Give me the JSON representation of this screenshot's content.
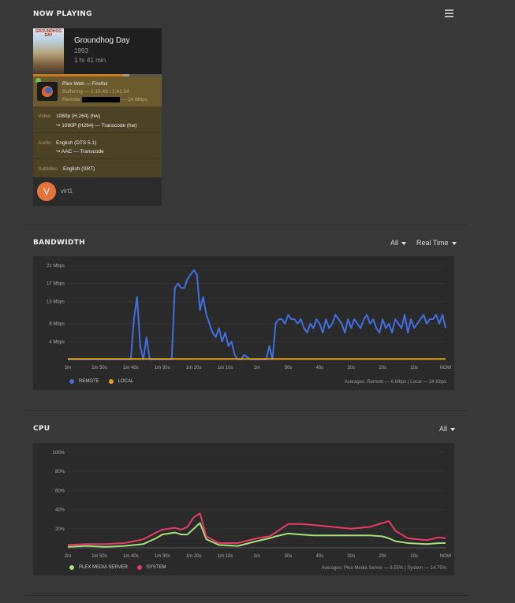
{
  "now_playing": {
    "title": "NOW PLAYING",
    "poster_text": "GROUNDHOG DAY",
    "movie_title": "Groundhog Day",
    "year": "1993",
    "duration": "1 hr 41 min",
    "progress": 0.7,
    "buffer": 0.75,
    "player_line1": "Plex Web  —  Firefox",
    "player_line2": "Buffering — 1:10:49 / 1:41:04",
    "player_remote_label": "Remote",
    "player_remote_suffix": "— 14 Mbps",
    "video_label": "Video",
    "video_value": "1080p (H.264) (hw)",
    "video_transcode": "↪  1080P (H264) — Transcode (hw)",
    "audio_label": "Audio",
    "audio_value": "English (DTS 5.1)",
    "audio_transcode": "↪  AAC — Transcode",
    "subtitles_label": "Subtitles",
    "subtitles_value": "English (SRT)",
    "avatar_letter": "V",
    "username": "virt1"
  },
  "bandwidth": {
    "title": "BANDWIDTH",
    "filter_label": "All",
    "range_label": "Real Time",
    "legend_remote": "REMOTE",
    "legend_local": "LOCAL",
    "averages": "Averages: Remote — 6 Mbps | Local — 24 Kbps",
    "remote_color": "#3f6fe0",
    "local_color": "#e8a020"
  },
  "cpu": {
    "title": "CPU",
    "filter_label": "All",
    "legend_server": "PLEX MEDIA SERVER",
    "legend_system": "SYSTEM",
    "averages": "Averages: Plex Media Server — 8.55% | System — 14.75%",
    "server_color": "#a6e07a",
    "system_color": "#e83a64"
  },
  "chart_data": [
    {
      "type": "line",
      "title": "BANDWIDTH",
      "x_ticks": [
        "2m",
        "1m 50s",
        "1m 40s",
        "1m 30s",
        "1m 20s",
        "1m 10s",
        "1m",
        "50s",
        "40s",
        "30s",
        "20s",
        "10s",
        "NOW"
      ],
      "y_ticks": [
        "4 Mbps",
        "8 Mbps",
        "13 Mbps",
        "17 Mbps",
        "21 Mbps"
      ],
      "ylim": [
        0,
        21
      ],
      "x_seconds_ago": [
        120,
        118,
        116,
        112,
        106,
        104,
        102,
        100,
        99,
        98,
        97,
        96,
        95,
        94,
        93,
        92,
        91,
        90,
        88,
        87,
        86,
        85,
        84,
        83,
        82,
        81,
        80,
        79,
        78,
        77,
        76,
        75,
        74,
        73,
        72,
        71,
        70,
        69,
        68,
        67,
        66,
        65,
        64,
        62,
        61,
        60,
        58,
        57,
        56,
        55,
        54,
        53,
        52,
        51,
        50,
        49,
        48,
        47,
        46,
        45,
        44,
        43,
        42,
        41,
        40,
        39,
        38,
        37,
        36,
        35,
        34,
        33,
        32,
        31,
        30,
        29,
        28,
        27,
        26,
        25,
        24,
        23,
        22,
        21,
        20,
        19,
        18,
        17,
        16,
        15,
        14,
        13,
        12,
        11,
        10,
        9,
        8,
        7,
        6,
        5,
        4,
        3,
        2,
        1,
        0
      ],
      "series": [
        {
          "name": "REMOTE",
          "values": [
            0,
            0,
            0,
            0,
            0,
            0,
            0,
            0,
            9,
            14,
            3,
            0,
            5,
            0,
            0,
            0,
            0,
            0,
            0,
            0,
            16,
            17,
            16,
            16,
            18,
            19,
            20,
            19,
            11,
            14,
            10,
            8,
            6,
            5,
            7,
            4,
            6,
            3,
            4,
            1,
            0,
            0,
            1,
            0,
            0,
            0,
            0,
            0,
            3,
            0,
            8,
            9,
            9,
            8,
            10,
            9,
            9,
            8,
            9,
            7,
            6,
            8,
            7,
            9,
            8,
            6,
            9,
            7,
            8,
            10,
            9,
            8,
            6,
            9,
            7,
            9,
            8,
            7,
            9,
            10,
            8,
            9,
            7,
            6,
            9,
            7,
            8,
            6,
            9,
            8,
            7,
            10,
            6,
            9,
            7,
            8,
            9,
            10,
            8,
            9,
            9,
            10,
            8,
            10,
            7
          ]
        },
        {
          "name": "LOCAL",
          "values": [
            0.1,
            0.1,
            0.1,
            0.1,
            0.1,
            0.1,
            0.1,
            0.1,
            0.1,
            0.1,
            0.1,
            0.1,
            0.1,
            0.1,
            0.1,
            0.1,
            0.1,
            0.1,
            0.1,
            0.1,
            0.1,
            0.1,
            0.1,
            0.1,
            0.1,
            0.1,
            0.1,
            0.1,
            0.1,
            0.1,
            0.1,
            0.1,
            0.1,
            0.1,
            0.1,
            0.1,
            0.1,
            0.1,
            0.1,
            0.1,
            0.1,
            0.1,
            0.1,
            0.1,
            0.1,
            0.1,
            0.1,
            0.1,
            0.1,
            0.1,
            0.1,
            0.1,
            0.1,
            0.1,
            0.1,
            0.1,
            0.1,
            0.1,
            0.1,
            0.1,
            0.1,
            0.1,
            0.1,
            0.1,
            0.1,
            0.1,
            0.1,
            0.1,
            0.1,
            0.1,
            0.1,
            0.1,
            0.1,
            0.1,
            0.1,
            0.1,
            0.1,
            0.1,
            0.1,
            0.1,
            0.1,
            0.1,
            0.1,
            0.1,
            0.1,
            0.1,
            0.1,
            0.1,
            0.1,
            0.1,
            0.1,
            0.1,
            0.1,
            0.1,
            0.1,
            0.1,
            0.1,
            0.1,
            0.1,
            0.1,
            0.1,
            0.1,
            0.1,
            0.1,
            0.1
          ]
        }
      ],
      "legend_position": "bottom-left"
    },
    {
      "type": "line",
      "title": "CPU",
      "x_ticks": [
        "2m",
        "1m 50s",
        "1m 40s",
        "1m 30s",
        "1m 20s",
        "1m 10s",
        "1m",
        "50s",
        "40s",
        "30s",
        "20s",
        "10s",
        "NOW"
      ],
      "y_ticks": [
        "20%",
        "40%",
        "60%",
        "80%",
        "100%"
      ],
      "ylim": [
        0,
        100
      ],
      "x_seconds_ago": [
        120,
        114,
        108,
        102,
        96,
        92,
        90,
        86,
        84,
        82,
        80,
        78,
        76,
        72,
        66,
        60,
        56,
        54,
        50,
        46,
        42,
        36,
        30,
        24,
        20,
        18,
        16,
        12,
        6,
        2,
        0
      ],
      "series": [
        {
          "name": "PLEX MEDIA SERVER",
          "values": [
            1,
            2,
            1,
            2,
            4,
            10,
            14,
            16,
            14,
            14,
            20,
            26,
            9,
            3,
            2,
            7,
            10,
            12,
            15,
            14,
            13,
            13,
            13,
            13,
            12,
            10,
            7,
            5,
            4,
            5,
            5
          ]
        },
        {
          "name": "SYSTEM",
          "values": [
            3,
            4,
            4,
            5,
            9,
            16,
            19,
            21,
            19,
            22,
            32,
            36,
            12,
            5,
            5,
            10,
            12,
            16,
            25,
            25,
            24,
            22,
            20,
            22,
            26,
            28,
            18,
            10,
            8,
            11,
            10
          ]
        }
      ],
      "legend_position": "bottom-left"
    }
  ]
}
